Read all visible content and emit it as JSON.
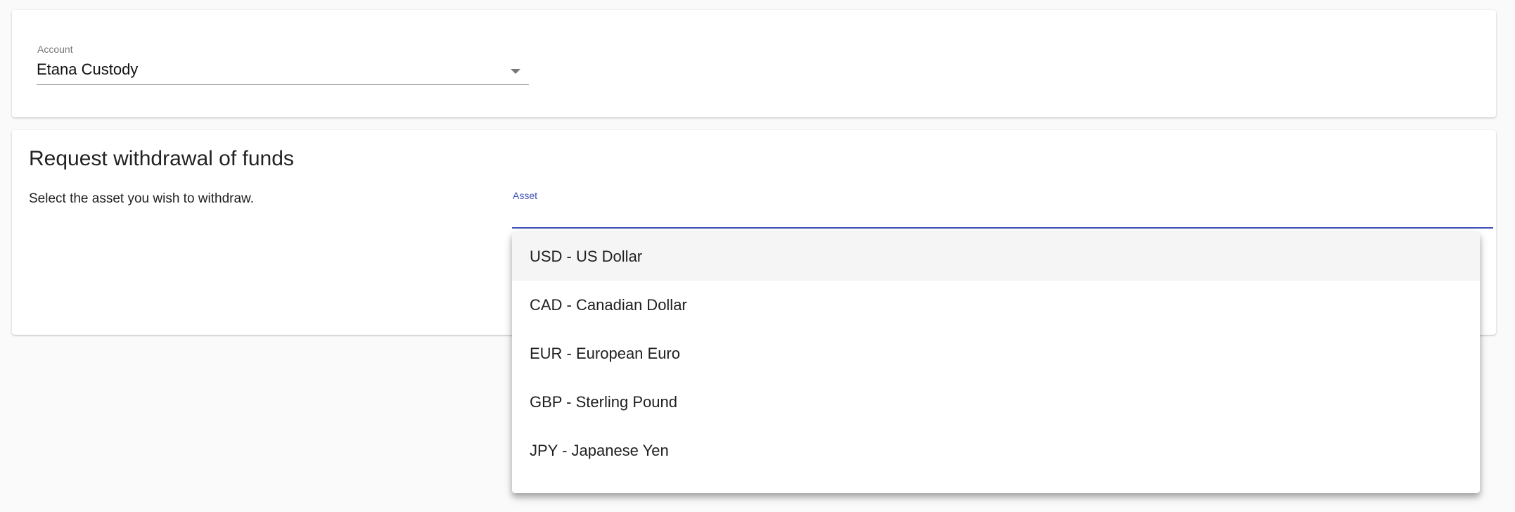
{
  "account": {
    "label": "Account",
    "value": "Etana Custody"
  },
  "withdrawal": {
    "title": "Request withdrawal of funds",
    "description": "Select the asset you wish to withdraw.",
    "asset_label": "Asset",
    "asset_value": ""
  },
  "asset_options": [
    {
      "label": "USD - US Dollar"
    },
    {
      "label": "CAD - Canadian Dollar"
    },
    {
      "label": "EUR - European Euro"
    },
    {
      "label": "GBP - Sterling Pound"
    },
    {
      "label": "JPY - Japanese Yen"
    }
  ],
  "icons": {
    "account_dropdown": "chevron-down-icon"
  },
  "colors": {
    "background": "#fafafa",
    "card": "#ffffff",
    "accent": "#3f51b5",
    "highlight": "#f5f5f5"
  }
}
